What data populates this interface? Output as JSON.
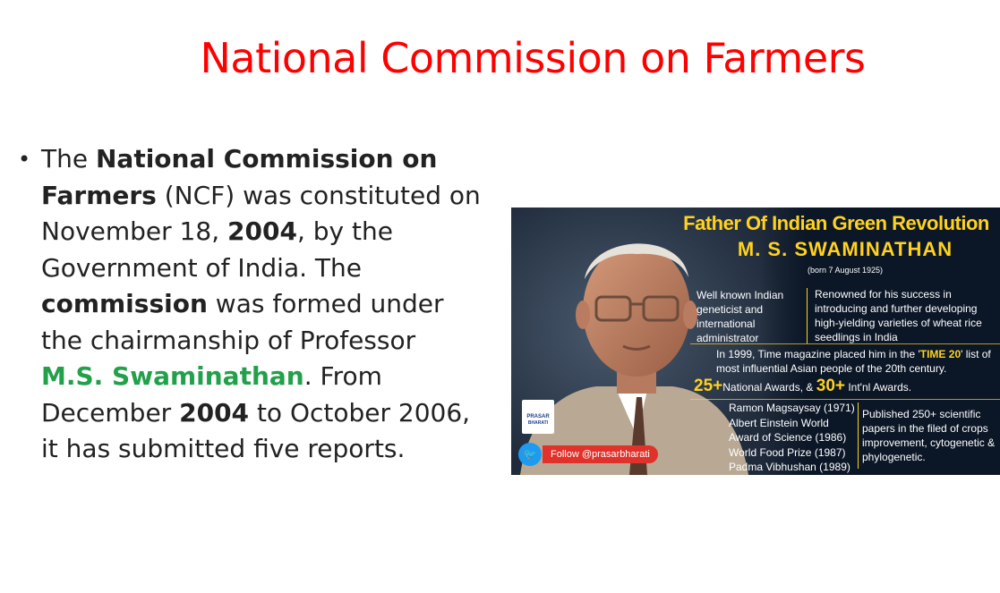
{
  "slide": {
    "title": "National Commission on Farmers",
    "bullet": {
      "p1": "The ",
      "b1": "National Commission on Farmers",
      "p2": " (NCF) was constituted on November 18, ",
      "b2": "2004",
      "p3": ", by the Government of India. The ",
      "b3": "commission",
      "p4": " was formed under the chairmanship of Professor ",
      "name": "M.S. Swaminathan",
      "p5": ". From December ",
      "b4": "2004",
      "p6": " to October 2006, it has submitted five reports."
    }
  },
  "poster": {
    "headline": "Father Of Indian  Green Revolution",
    "name": "M. S. SWAMINATHAN",
    "born": "(born 7 August 1925)",
    "col1": "Well known Indian geneticist and international administrator",
    "col2": "Renowned for his success in introducing and further developing high-yielding varieties of wheat rice seedlings in India",
    "time_pre": "In 1999, Time magazine placed him in the '",
    "time_hl": "TIME 20",
    "time_post": "' list of most influential Asian people of the 20th century.",
    "awards_n1": "25+",
    "awards_t1": "National Awards, & ",
    "awards_n2": "30+",
    "awards_t2": " Int'nl Awards.",
    "prizes": [
      "Ramon Magsaysay (1971)",
      "Albert Einstein World",
      "Award of Science (1986)",
      "World Food Prize (1987)",
      "Padma Vibhushan (1989)"
    ],
    "pubs": "Published 250+ scientific papers in the filed of crops improvement, cytogenetic & phylogenetic.",
    "logo_l1": "PRASAR",
    "logo_l2": "BHARATI",
    "follow": "Follow @prasarbharati",
    "colors": {
      "accent": "#ffd21f",
      "title_red": "#ff0000",
      "name_green": "#22a04a"
    }
  }
}
